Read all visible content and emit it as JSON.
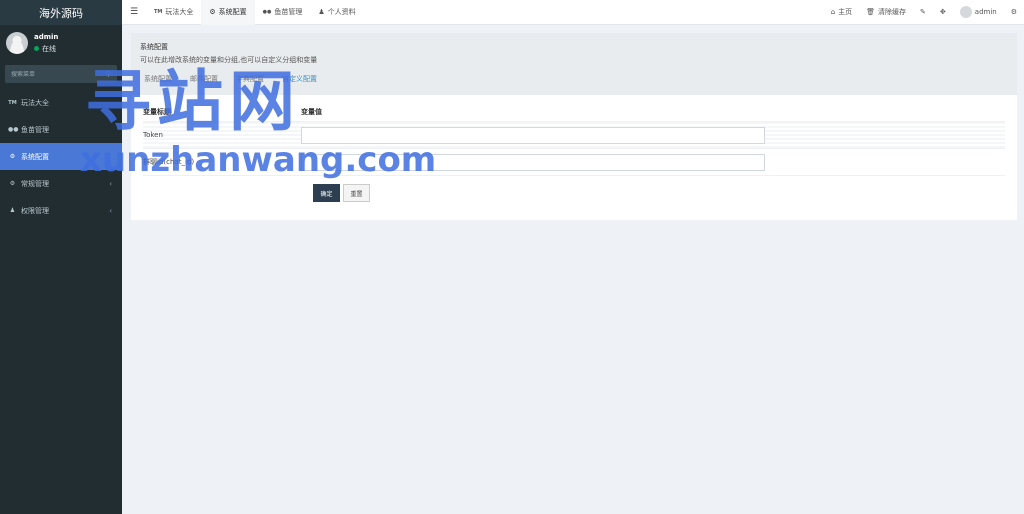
{
  "sidebar": {
    "logo": "海外源码",
    "user": {
      "name": "admin",
      "status": "在线"
    },
    "search": {
      "placeholder": "搜索菜单"
    },
    "items": [
      {
        "label": "玩法大全",
        "icon": "tm-icon"
      },
      {
        "label": "鱼苗管理",
        "icon": "glasses-icon"
      },
      {
        "label": "系统配置",
        "icon": "gear-icon",
        "active": true
      },
      {
        "label": "常规管理",
        "icon": "cogs-icon"
      },
      {
        "label": "权限管理",
        "icon": "users-icon"
      }
    ]
  },
  "topbar": {
    "tabs": [
      {
        "label": "玩法大全",
        "icon": "tm-icon"
      },
      {
        "label": "系统配置",
        "icon": "gear-icon",
        "active": true
      },
      {
        "label": "鱼苗管理",
        "icon": "glasses-icon"
      },
      {
        "label": "个人资料",
        "icon": "user-icon"
      }
    ],
    "right": {
      "home": "主页",
      "clear_cache": "清除缓存",
      "user": "admin"
    }
  },
  "panel": {
    "title": "系统配置",
    "desc": "可以在此增改系统的变量和分组,也可以自定义分组和变量",
    "subtabs": [
      "系统配置",
      "邮件配置",
      "字典配置",
      "自定义配置"
    ],
    "table": {
      "headers": [
        "变量标题",
        "变量值"
      ],
      "rows": [
        {
          "label": "Token",
          "value": ""
        },
        {
          "label": "群聊id(chat_id)",
          "value": ""
        }
      ]
    },
    "buttons": {
      "ok": "确定",
      "reset": "重置"
    }
  },
  "watermark": {
    "cn": "寻站网",
    "en": "xunzhanwang.com"
  },
  "colors": {
    "sidebar_bg": "#222d32",
    "active_item": "#4a78d6",
    "watermark": "#3f6ee0"
  }
}
